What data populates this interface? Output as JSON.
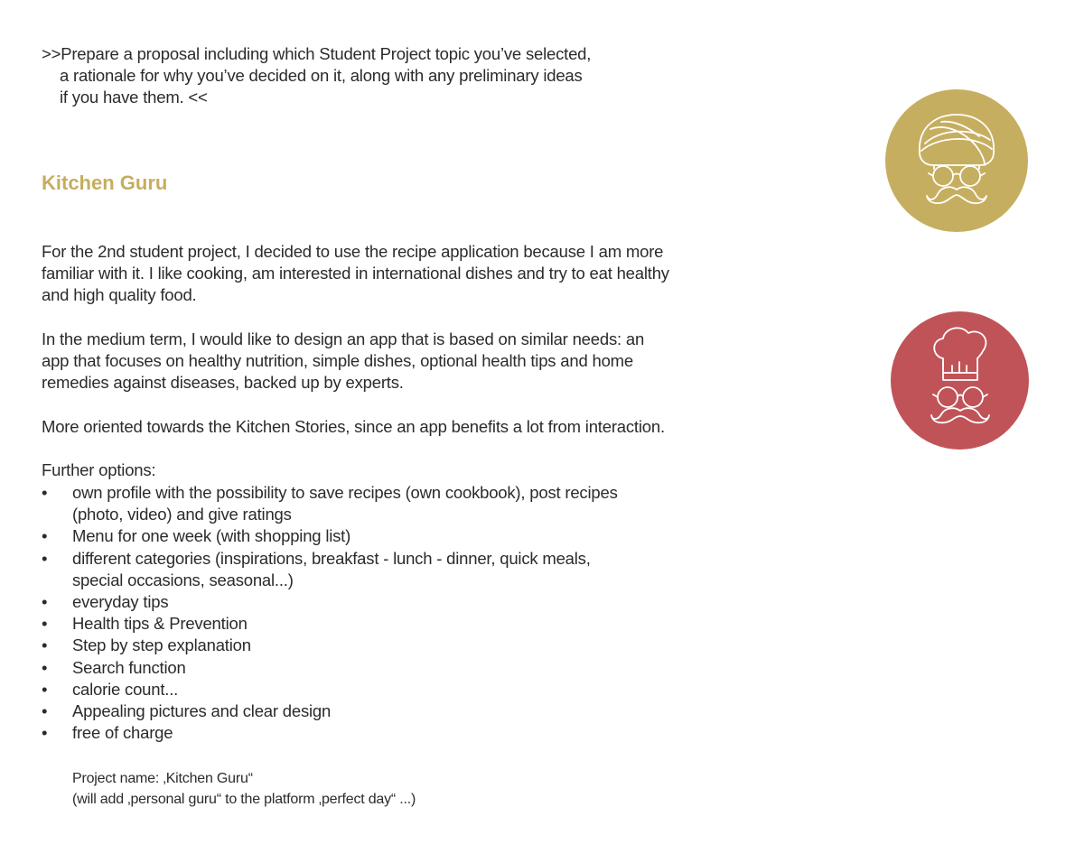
{
  "intro": {
    "line1": ">>Prepare a proposal including which Student Project topic you’ve selected,",
    "line2": "a rationale for why you’ve decided on it, along with any preliminary ideas",
    "line3": "if you have them. <<"
  },
  "heading": "Kitchen Guru",
  "paragraphs": {
    "p1": "For the 2nd student project, I decided to use the recipe application because I am more familiar with it. I like cooking, am interested in international dishes and try to eat healthy and high quality food.",
    "p2": "In the medium term, I would like to design an app that is based on similar needs: an app that focuses on healthy nutrition, simple dishes, optional health tips and home remedies against diseases, backed up by experts.",
    "p3": "More oriented towards the Kitchen Stories, since an app benefits a lot from interaction.",
    "p4": "Further options:"
  },
  "bullet_char": "•",
  "options": [
    "own profile with the possibility to save recipes (own cookbook), post recipes (photo, video) and give ratings",
    "Menu for one week (with shopping list)",
    "different categories (inspirations, breakfast - lunch - dinner, quick meals, special occasions, seasonal...)",
    "everyday tips",
    "Health tips & Prevention",
    "Step by step explanation",
    "Search function",
    "calorie count...",
    "Appealing pictures and clear design",
    "free of charge"
  ],
  "project": {
    "name_line": "Project name: ‚Kitchen Guru“",
    "note_line": "(will add  ‚personal guru“ to the platform ‚perfect day“ ...)"
  },
  "icons": {
    "guru": {
      "name": "guru-turban-icon",
      "color": "#c6ae60"
    },
    "chef": {
      "name": "chef-hat-icon",
      "color": "#c05358"
    }
  }
}
